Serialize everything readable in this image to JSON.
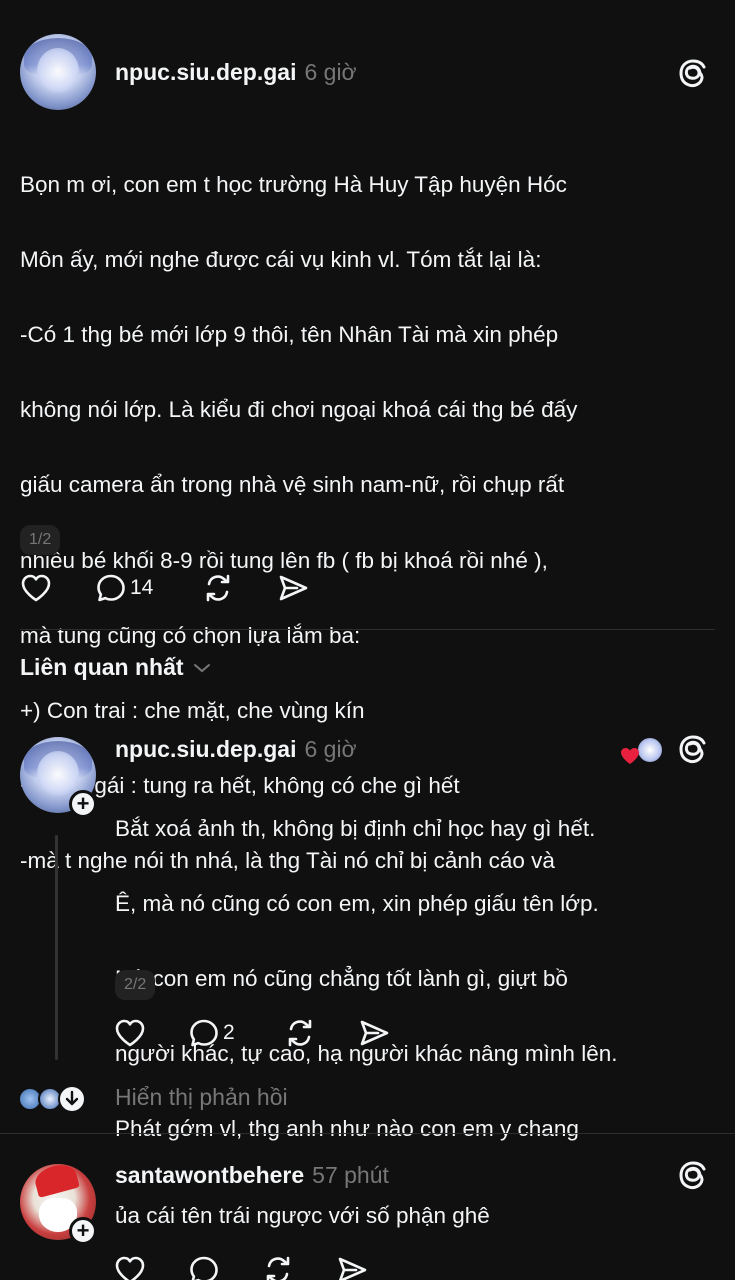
{
  "post": {
    "username": "npuc.siu.dep.gai",
    "time": "6 giờ",
    "lines": [
      "Bọn m ơi, con em t học trường Hà Huy Tập huyện Hóc",
      "Môn ấy, mới nghe được cái vụ kinh vl. Tóm tắt lại là:",
      "-Có 1 thg bé mới lớp 9 thôi, tên Nhân Tài mà xin phép",
      "không nói lớp. Là kiểu đi chơi ngoại khoá cái thg bé đấy",
      "giấu camera ẩn trong nhà vệ sinh nam-nữ, rồi chụp rất",
      "nhiều bé khối 8-9 rồi tung lên fb ( fb bị khoá rồi nhé ),",
      "mà tung cũng có chọn lựa lắm ba:",
      "+) Con trai : che mặt, che vùng kín",
      "+) Con gái : tung ra hết, không có che gì hết",
      "-mà t nghe nói th nhá, là thg Tài nó chỉ bị cảnh cáo và"
    ],
    "pager": "1/2",
    "reply_count": "14"
  },
  "sort": {
    "label": "Liên quan nhất"
  },
  "reply1": {
    "username": "npuc.siu.dep.gai",
    "time": "6 giờ",
    "lines": [
      "Bắt xoá ảnh th, không bị định chỉ học hay gì hết.",
      "Ê, mà nó cũng có con em, xin phép giấu tên lớp.",
      "Mà con em nó cũng chẳng tốt lành gì, giựt bồ",
      "người khác, tự cao, hạ người khác nâng mình lên.",
      "Phát gớm vl, thg anh như nào con em y chang"
    ],
    "pager": "2/2",
    "reply_count": "2",
    "show_replies": "Hiển thị phản hồi"
  },
  "reply2": {
    "username": "santawontbehere",
    "time": "57 phút",
    "text": "ủa cái tên trái ngược với số phận ghê"
  },
  "colors": {
    "background": "#101010",
    "text": "#f3f5f7",
    "muted": "#777777",
    "like_heart": "#e8213f"
  }
}
